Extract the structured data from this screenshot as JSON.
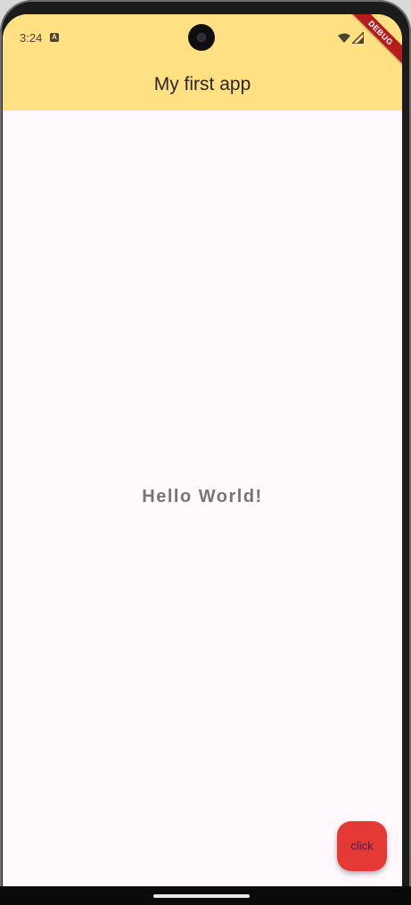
{
  "status_bar": {
    "time": "3:24",
    "notification_icon": "a-icon",
    "wifi_icon": "wifi-icon",
    "signal_icon": "cell-signal-icon"
  },
  "app_bar": {
    "title": "My first app",
    "color": "#ffe083"
  },
  "debug_banner": {
    "label": "DEBUG",
    "color": "#b71c1c"
  },
  "body": {
    "text": "Hello World!",
    "background": "#fff8fd"
  },
  "fab": {
    "label": "click",
    "color": "#e53935"
  }
}
